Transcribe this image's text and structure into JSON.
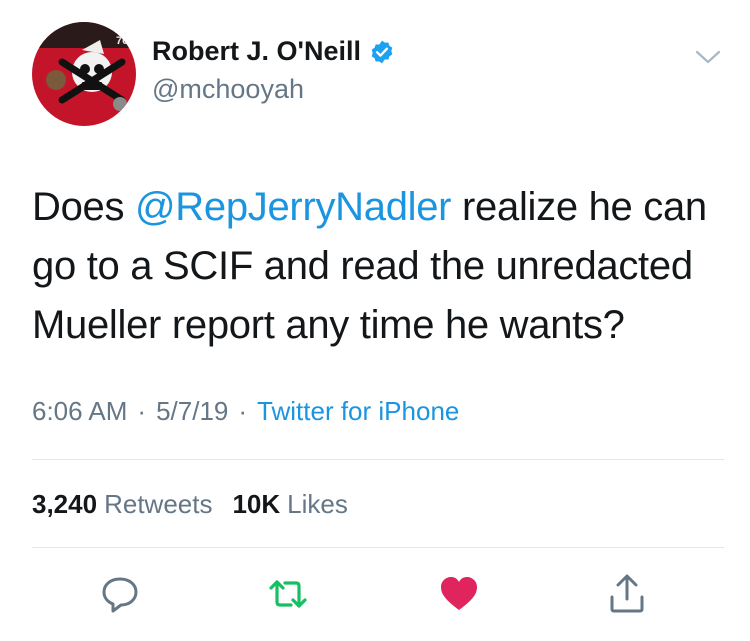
{
  "tweet": {
    "author": {
      "display_name": "Robert J. O'Neill",
      "handle": "@mchooyah",
      "verified": true,
      "avatar_badge_text": "708"
    },
    "text_before_mention": "Does ",
    "mention": "@RepJerryNadler",
    "text_after_mention": " realize he can go to a SCIF and read the unredacted Mueller report any time he wants?",
    "time": "6:06 AM",
    "date": "5/7/19",
    "separator": "·",
    "source": "Twitter for iPhone",
    "stats": {
      "retweets_count": "3,240",
      "retweets_label": "Retweets",
      "likes_count": "10K",
      "likes_label": "Likes"
    },
    "liked": true
  },
  "colors": {
    "link": "#1b95e0",
    "secondary_text": "#657786",
    "retweet_green": "#17bf63",
    "like_red": "#e0245e",
    "divider": "#e1e8ed",
    "verified_blue": "#1da1f2"
  }
}
